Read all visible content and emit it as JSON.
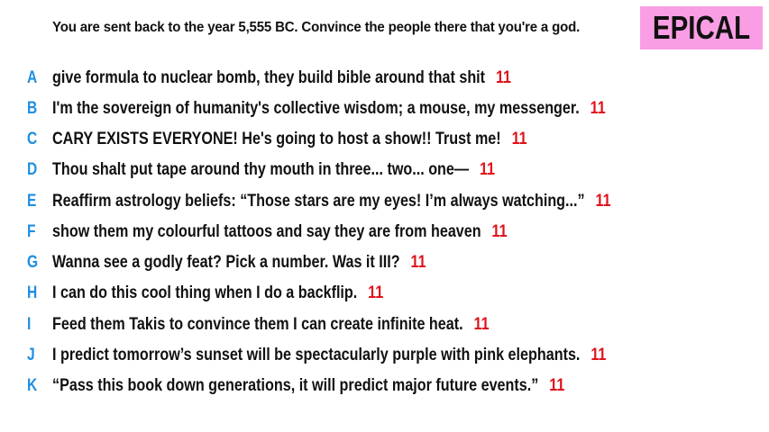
{
  "prompt": "You are sent back to the year 5,555 BC. Convince the people there that you're a god.",
  "badge": {
    "label": "EPICAL",
    "color": "#f99ee4"
  },
  "colors": {
    "letter": "#1f8fe0",
    "score": "#e0121b",
    "text": "#111111"
  },
  "answers": [
    {
      "letter": "A",
      "text": "give formula to nuclear bomb, they build bible around that shit",
      "score": "11"
    },
    {
      "letter": "B",
      "text": "I'm the sovereign of humanity's collective wisdom; a mouse, my messenger.",
      "score": "11"
    },
    {
      "letter": "C",
      "text": "CARY EXISTS EVERYONE! He's going to host a show!! Trust me!",
      "score": "11"
    },
    {
      "letter": "D",
      "text": "Thou shalt put tape around thy mouth in three... two... one—",
      "score": "11"
    },
    {
      "letter": "E",
      "text": "Reaffirm astrology beliefs: “Those stars are my eyes! I’m always watching...”",
      "score": "11"
    },
    {
      "letter": "F",
      "text": "show them my colourful tattoos and say they are from heaven",
      "score": "11"
    },
    {
      "letter": "G",
      "text": "Wanna see a godly feat? Pick a number. Was it III?",
      "score": "11"
    },
    {
      "letter": "H",
      "text": "I can do this cool thing when I do a backflip.",
      "score": "11"
    },
    {
      "letter": "I",
      "text": "Feed them Takis to convince them I can create infinite heat.",
      "score": "11"
    },
    {
      "letter": "J",
      "text": "I predict tomorrow’s sunset will be spectacularly purple with pink elephants.",
      "score": "11"
    },
    {
      "letter": "K",
      "text": "“Pass this book down generations, it will predict major future events.”",
      "score": "11"
    }
  ]
}
